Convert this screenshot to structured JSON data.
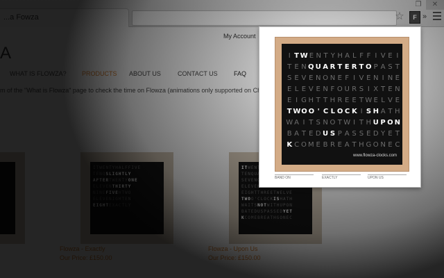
{
  "browser": {
    "tab_title": "...a Fowza",
    "star_icon": "star-icon",
    "extension_icon": "F",
    "overflow_chevron": "»"
  },
  "page": {
    "top_links": "My Account",
    "logo_fragment": "A",
    "nav": [
      "WHAT IS FLOWZA?",
      "PRODUCTS",
      "ABOUT US",
      "CONTACT US",
      "FAQ"
    ],
    "notice": "m of the \"What is Flowza\" page to check the time on Flowza (animations only supported on Chrome, Sa",
    "products": [
      {
        "name": "Flowza - Exactly",
        "price": "Our Price: £150.00"
      },
      {
        "name": "Flowza - Upon Us",
        "price": "Our Price: £150.00"
      }
    ]
  },
  "popup": {
    "rows": [
      "ITWENTYHALFFIVEI",
      "TENQUARTERTOPAST",
      "SEVENONEFIVENINE",
      "ELEVENFOURSIXTEN",
      "EIGHTTHREETWELVE",
      "TWOO'CLOCKISHATH",
      "WAITSNOTWITHUPON",
      "BATEDUSPASSEDYET",
      "KCOMEBREATHGONEC"
    ],
    "lit": [
      [
        1,
        2
      ],
      [
        3,
        4,
        5,
        6,
        7,
        8,
        9,
        10,
        11
      ],
      [],
      [],
      [],
      [
        0,
        1,
        2,
        3,
        4,
        5,
        6,
        7,
        8,
        9,
        11,
        12
      ],
      [
        12,
        13,
        14,
        15
      ],
      [
        5,
        6
      ],
      [
        0
      ]
    ],
    "website": "www.flowza-clocks.com",
    "options": [
      "BAND ON",
      "EXACTLY",
      "UPON US"
    ]
  }
}
